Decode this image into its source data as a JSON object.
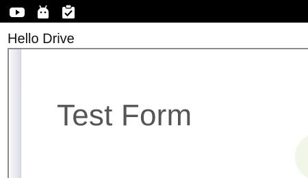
{
  "status_bar": {
    "icons": [
      "youtube-icon",
      "android-icon",
      "clipboard-check-icon"
    ]
  },
  "app": {
    "title": "Hello Drive"
  },
  "preview": {
    "form_title": "Test Form"
  },
  "colors": {
    "status_bar": "#000000",
    "frame_border": "#8a8a8a",
    "form_title": "#555555"
  }
}
